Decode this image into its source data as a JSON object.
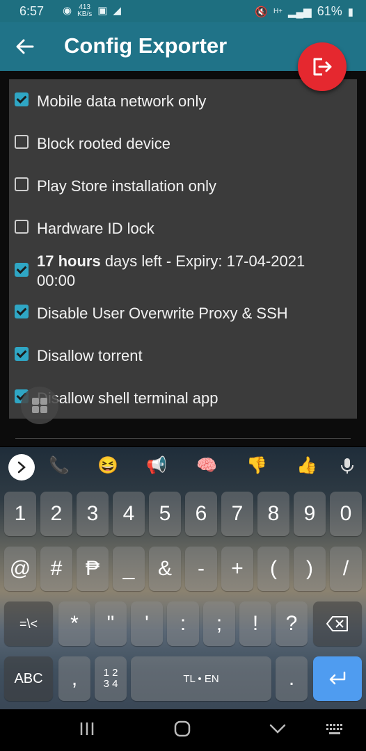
{
  "status_bar": {
    "time": "6:57",
    "net_speed": "413",
    "net_unit": "KB/s",
    "battery_pct": "61%"
  },
  "app_bar": {
    "title": "Config Exporter"
  },
  "options": [
    {
      "label": "Mobile data network only",
      "checked": true
    },
    {
      "label": "Block rooted device",
      "checked": false
    },
    {
      "label": "Play Store installation only",
      "checked": false
    },
    {
      "label": "Hardware ID lock",
      "checked": false
    },
    {
      "label_bold": "17 hours",
      "label": " days left - Expiry: 17-04-2021 00:00",
      "checked": true
    },
    {
      "label": "Disable User Overwrite Proxy & SSH",
      "checked": true
    },
    {
      "label": "Disallow torrent",
      "checked": true
    },
    {
      "label": "Disallow shell terminal app",
      "checked": true
    }
  ],
  "keyboard": {
    "suggestions": [
      "📞",
      "😆",
      "📢",
      "🧠",
      "👎",
      "👍"
    ],
    "row1": [
      "1",
      "2",
      "3",
      "4",
      "5",
      "6",
      "7",
      "8",
      "9",
      "0"
    ],
    "row2": [
      "@",
      "#",
      "₱",
      "_",
      "&",
      "-",
      "+",
      "(",
      ")",
      "/"
    ],
    "row3_mode": "=\\<",
    "row3": [
      "*",
      "\"",
      "'",
      ":",
      ";",
      "!",
      "?"
    ],
    "abc": "ABC",
    "comma": ",",
    "numpad_top": "1 2",
    "numpad_bottom": "3 4",
    "space": "TL • EN",
    "period": "."
  }
}
